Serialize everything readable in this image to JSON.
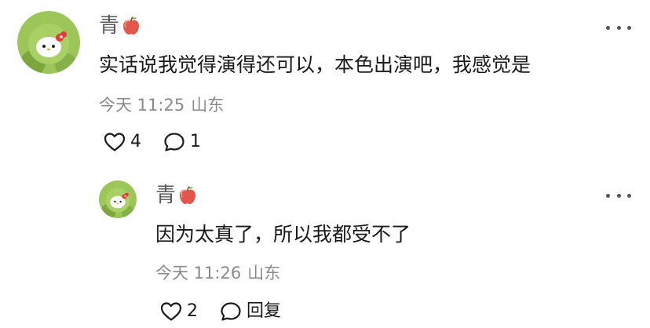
{
  "comments": [
    {
      "username": "青",
      "badge_icon": "apple-icon",
      "text": "实话说我觉得演得还可以，本色出演吧，我感觉是",
      "time": "今天 11:25",
      "location": "山东",
      "likes": "4",
      "replies": "1"
    },
    {
      "username": "青",
      "badge_icon": "apple-icon",
      "text": "因为太真了，所以我都受不了",
      "time": "今天 11:26",
      "location": "山东",
      "likes": "2",
      "reply_label": "回复"
    }
  ],
  "icons": {
    "like": "heart-outline-icon",
    "comment": "speech-bubble-icon",
    "more": "more-dots-icon"
  },
  "colors": {
    "text_primary": "#1a1a1a",
    "text_secondary": "#8a8a8a",
    "username": "#5a5a5a",
    "avatar_green": "#8fbf4a",
    "apple_red": "#e2574c"
  }
}
